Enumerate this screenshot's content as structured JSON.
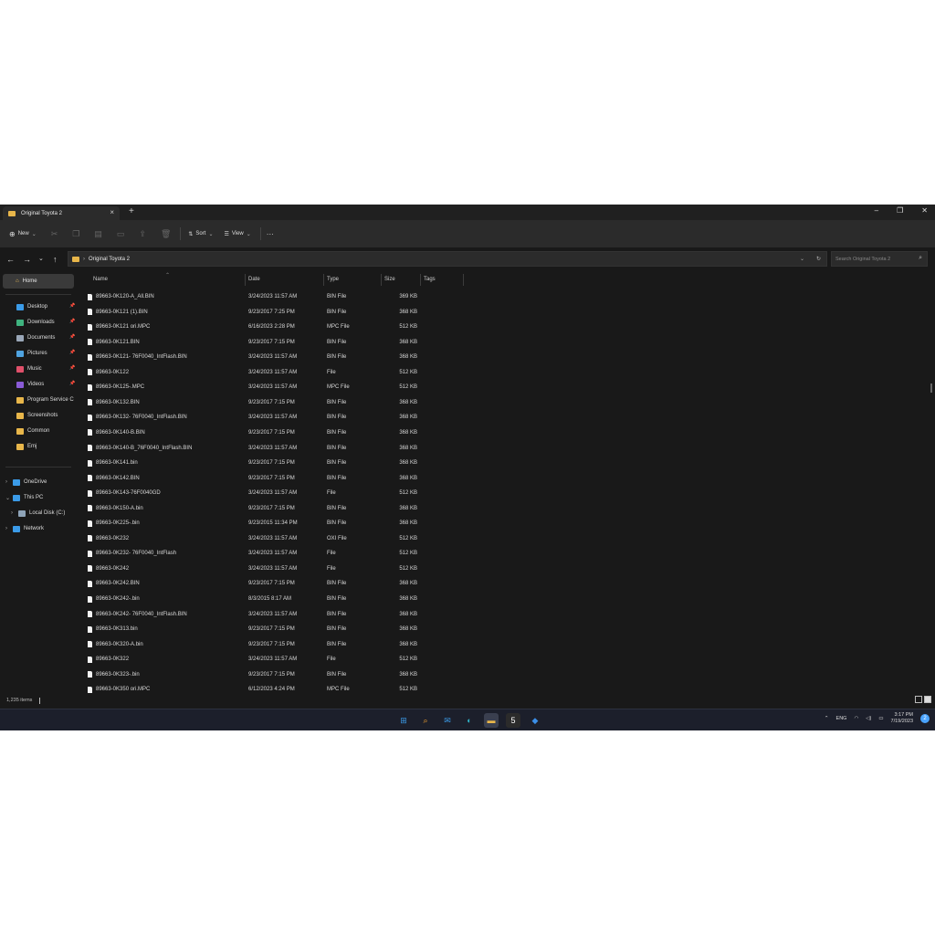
{
  "window": {
    "tab_title": "Original Toyota 2",
    "new_tab": "+",
    "close_tab": "×",
    "min": "–",
    "max": "❐",
    "close": "✕"
  },
  "toolbar": {
    "new_label": "New",
    "sort_label": "Sort",
    "view_label": "View",
    "more": "···"
  },
  "address": {
    "path_sep": "›",
    "path": "Original Toyota 2",
    "search_placeholder": "Search Original Toyota 2"
  },
  "sidebar": {
    "home": "Home",
    "quick_access": [
      {
        "label": "Desktop",
        "pinned": true,
        "color": "#3b9be8"
      },
      {
        "label": "Downloads",
        "pinned": true,
        "color": "#3fb37f"
      },
      {
        "label": "Documents",
        "pinned": true,
        "color": "#9aa7b8"
      },
      {
        "label": "Pictures",
        "pinned": true,
        "color": "#4fa3e0"
      },
      {
        "label": "Music",
        "pinned": true,
        "color": "#e0506a"
      },
      {
        "label": "Videos",
        "pinned": true,
        "color": "#8a5bd6"
      },
      {
        "label": "Program Service C",
        "pinned": false,
        "color": "#e8b64a"
      },
      {
        "label": "Screenshots",
        "pinned": false,
        "color": "#e8b64a"
      },
      {
        "label": "Common",
        "pinned": false,
        "color": "#e8b64a"
      },
      {
        "label": "Emj",
        "pinned": false,
        "color": "#e8b64a"
      }
    ],
    "tree": [
      {
        "label": "OneDrive",
        "color": "#3b9be8"
      },
      {
        "label": "This PC",
        "color": "#3b9be8"
      },
      {
        "label": "Local Disk (C:)",
        "color": "#8fa4b8"
      },
      {
        "label": "Network",
        "color": "#3b9be8"
      }
    ]
  },
  "columns": {
    "name": "Name",
    "date": "Date",
    "type": "Type",
    "size": "Size",
    "tags": "Tags"
  },
  "files": [
    {
      "name": "89663-0K120-A_All.BIN",
      "date": "3/24/2023 11:57 AM",
      "type": "BIN File",
      "size": "369 KB"
    },
    {
      "name": "89663-0K121 (1).BIN",
      "date": "9/23/2017 7:25 PM",
      "type": "BIN File",
      "size": "368 KB"
    },
    {
      "name": "89663-0K121 ori.MPC",
      "date": "6/16/2023 2:28 PM",
      "type": "MPC File",
      "size": "512 KB"
    },
    {
      "name": "89663-0K121.BIN",
      "date": "9/23/2017 7:15 PM",
      "type": "BIN File",
      "size": "368 KB"
    },
    {
      "name": "89663-0K121- 76F0040_IntFlash.BIN",
      "date": "3/24/2023 11:57 AM",
      "type": "BIN File",
      "size": "368 KB"
    },
    {
      "name": "89663-0K122",
      "date": "3/24/2023 11:57 AM",
      "type": "File",
      "size": "512 KB"
    },
    {
      "name": "89663-0K125-.MPC",
      "date": "3/24/2023 11:57 AM",
      "type": "MPC File",
      "size": "512 KB"
    },
    {
      "name": "89663-0K132.BIN",
      "date": "9/23/2017 7:15 PM",
      "type": "BIN File",
      "size": "368 KB"
    },
    {
      "name": "89663-0K132- 76F0040_IntFlash.BIN",
      "date": "3/24/2023 11:57 AM",
      "type": "BIN File",
      "size": "368 KB"
    },
    {
      "name": "89663-0K140-B.BIN",
      "date": "9/23/2017 7:15 PM",
      "type": "BIN File",
      "size": "368 KB"
    },
    {
      "name": "89663-0K140-B_76F0040_IntFlash.BIN",
      "date": "3/24/2023 11:57 AM",
      "type": "BIN File",
      "size": "368 KB"
    },
    {
      "name": "89663-0K141.bin",
      "date": "9/23/2017 7:15 PM",
      "type": "BIN File",
      "size": "368 KB"
    },
    {
      "name": "89663-0K142.BIN",
      "date": "9/23/2017 7:15 PM",
      "type": "BIN File",
      "size": "368 KB"
    },
    {
      "name": "89663-0K143-76F0040GD",
      "date": "3/24/2023 11:57 AM",
      "type": "File",
      "size": "512 KB"
    },
    {
      "name": "89663-0K150-A.bin",
      "date": "9/23/2017 7:15 PM",
      "type": "BIN File",
      "size": "368 KB"
    },
    {
      "name": "89663-0K225-.bin",
      "date": "9/23/2015 11:34 PM",
      "type": "BIN File",
      "size": "368 KB"
    },
    {
      "name": "89663-0K232",
      "date": "3/24/2023 11:57 AM",
      "type": "OXI File",
      "size": "512 KB"
    },
    {
      "name": "89663-0K232- 76F0040_IntFlash",
      "date": "3/24/2023 11:57 AM",
      "type": "File",
      "size": "512 KB"
    },
    {
      "name": "89663-0K242",
      "date": "3/24/2023 11:57 AM",
      "type": "File",
      "size": "512 KB"
    },
    {
      "name": "89663-0K242.BIN",
      "date": "9/23/2017 7:15 PM",
      "type": "BIN File",
      "size": "368 KB"
    },
    {
      "name": "89663-0K242-.bin",
      "date": "8/3/2015 8:17 AM",
      "type": "BIN File",
      "size": "368 KB"
    },
    {
      "name": "89663-0K242- 76F0040_IntFlash.BIN",
      "date": "3/24/2023 11:57 AM",
      "type": "BIN File",
      "size": "368 KB"
    },
    {
      "name": "89663-0K313.bin",
      "date": "9/23/2017 7:15 PM",
      "type": "BIN File",
      "size": "368 KB"
    },
    {
      "name": "89663-0K320-A.bin",
      "date": "9/23/2017 7:15 PM",
      "type": "BIN File",
      "size": "368 KB"
    },
    {
      "name": "89663-0K322",
      "date": "3/24/2023 11:57 AM",
      "type": "File",
      "size": "512 KB"
    },
    {
      "name": "89663-0K323-.bin",
      "date": "9/23/2017 7:15 PM",
      "type": "BIN File",
      "size": "368 KB"
    },
    {
      "name": "89663-0K350 ori.MPC",
      "date": "6/12/2023 4:24 PM",
      "type": "MPC File",
      "size": "512 KB"
    }
  ],
  "status": {
    "count": "1,235 items"
  },
  "taskbar": {
    "apps": [
      {
        "name": "start-icon",
        "glyph": "⊞",
        "color": "#3b9be8"
      },
      {
        "name": "search-icon",
        "glyph": "⌕",
        "color": "#f0a030"
      },
      {
        "name": "mail-icon",
        "glyph": "✉",
        "color": "#3b9be8"
      },
      {
        "name": "edge-icon",
        "glyph": "◐",
        "color": "#2fb5c8"
      },
      {
        "name": "file-explorer-icon",
        "glyph": "▬",
        "color": "#e8b64a"
      },
      {
        "name": "app-5-icon",
        "glyph": "5",
        "color": "#ffffff"
      },
      {
        "name": "defender-icon",
        "glyph": "◆",
        "color": "#3b8fe8"
      }
    ],
    "lang": "ENG",
    "time": "3:17 PM",
    "date": "7/19/2023",
    "notifications": "2"
  }
}
